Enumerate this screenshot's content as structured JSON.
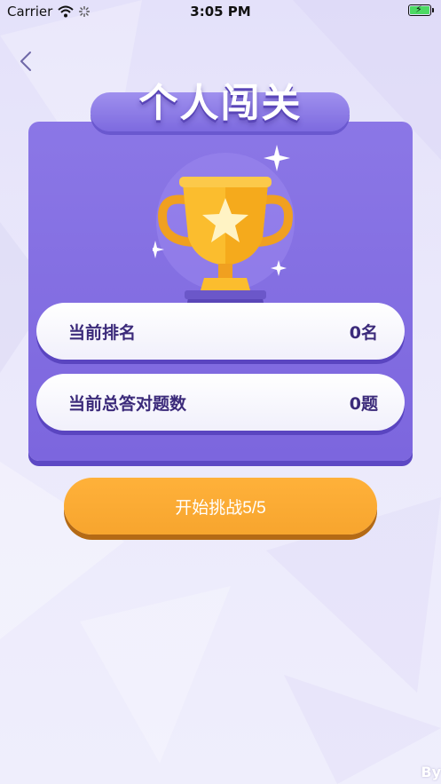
{
  "status_bar": {
    "carrier": "Carrier",
    "time": "3:05 PM"
  },
  "header": {
    "title": "个人闯关"
  },
  "stats": [
    {
      "label": "当前排名",
      "value": "0名"
    },
    {
      "label": "当前总答对题数",
      "value": "0题"
    }
  ],
  "actions": {
    "start_label": "开始挑战5/5"
  },
  "corner": {
    "text": "By"
  },
  "icons": {
    "back": "chevron-left-icon",
    "trophy": "trophy-icon",
    "wifi": "wifi-icon",
    "battery": "battery-icon"
  },
  "colors": {
    "card": "#8b77e6",
    "banner": "#7d6adf",
    "button": "#ffb13a",
    "text_dark": "#3b2a7a",
    "trophy_gold": "#fbbd2e"
  }
}
